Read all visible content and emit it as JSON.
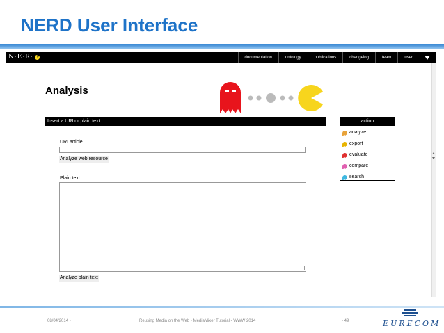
{
  "slide": {
    "title": "NERD User Interface",
    "footer_date": "08/04/2014 -",
    "footer_center": "Reusing Media on the Web - MediaMixer Tutorial - WWW 2014",
    "footer_page": "- 49",
    "org_logo_text": "EURECOM"
  },
  "app": {
    "logo_text": "N·E·R·",
    "nav": [
      "documentation",
      "ontology",
      "publications",
      "changelog",
      "team",
      "user"
    ],
    "page_heading": "Analysis",
    "panel_header": "Insert a URI or plain text",
    "uri_label": "URI article",
    "uri_value": "",
    "analyze_web_button": "Analyze web resource",
    "plain_label": "Plain text",
    "plain_value": "",
    "analyze_plain_button": "Analyze plain text",
    "action": {
      "title": "action",
      "items": [
        {
          "label": "analyze",
          "color": "#e8a33a"
        },
        {
          "label": "export",
          "color": "#e8b400"
        },
        {
          "label": "evaluate",
          "color": "#e03030"
        },
        {
          "label": "compare",
          "color": "#e060b0"
        },
        {
          "label": "search",
          "color": "#40b8e0"
        }
      ]
    }
  },
  "colors": {
    "title_blue": "#1e73c8",
    "ghost_red": "#e8141c",
    "pacman_yellow": "#f7d51d",
    "dot_grey": "#bbbbbb"
  }
}
